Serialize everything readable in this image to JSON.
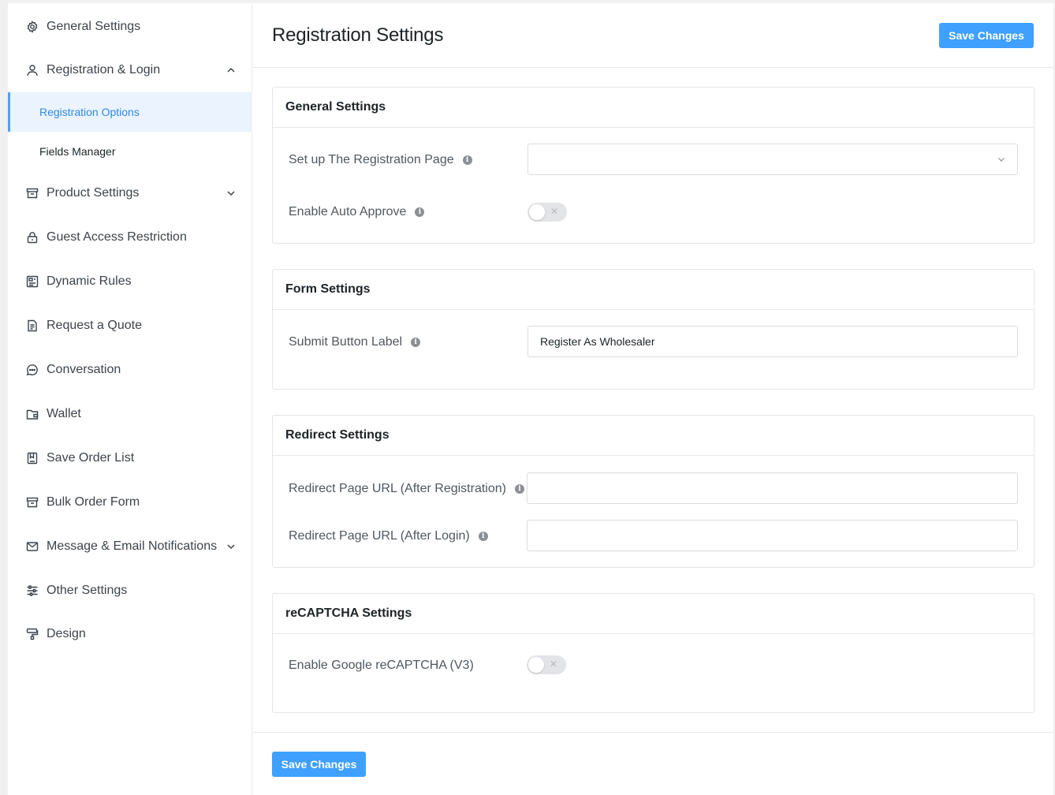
{
  "sidebar": {
    "items": [
      {
        "label": "General Settings",
        "icon": "gear-icon"
      },
      {
        "label": "Registration & Login",
        "icon": "user-icon",
        "expanded": true
      },
      {
        "label": "Product Settings",
        "icon": "archive-box-icon"
      },
      {
        "label": "Guest Access Restriction",
        "icon": "lock-icon"
      },
      {
        "label": "Dynamic Rules",
        "icon": "rules-icon"
      },
      {
        "label": "Request a Quote",
        "icon": "document-icon"
      },
      {
        "label": "Conversation",
        "icon": "chat-bubble-icon"
      },
      {
        "label": "Wallet",
        "icon": "wallet-icon"
      },
      {
        "label": "Save Order List",
        "icon": "bookmark-icon"
      },
      {
        "label": "Bulk Order Form",
        "icon": "archive-box-icon"
      },
      {
        "label": "Message & Email Notifications",
        "icon": "envelope-icon"
      },
      {
        "label": "Other Settings",
        "icon": "sliders-icon"
      },
      {
        "label": "Design",
        "icon": "paint-roller-icon"
      }
    ],
    "sub_items": [
      {
        "label": "Registration Options",
        "active": true
      },
      {
        "label": "Fields Manager",
        "active": false
      }
    ]
  },
  "header": {
    "title": "Registration Settings",
    "save_label": "Save Changes"
  },
  "sections": {
    "general": {
      "title": "General Settings",
      "registration_page_label": "Set up The Registration Page",
      "registration_page_value": "",
      "auto_approve_label": "Enable Auto Approve",
      "auto_approve_on": false
    },
    "form": {
      "title": "Form Settings",
      "submit_label_label": "Submit Button Label",
      "submit_label_value": "Register As Wholesaler"
    },
    "redirect": {
      "title": "Redirect Settings",
      "after_registration_label": "Redirect Page URL (After Registration)",
      "after_registration_value": "",
      "after_login_label": "Redirect Page URL (After Login)",
      "after_login_value": ""
    },
    "recaptcha": {
      "title": "reCAPTCHA Settings",
      "enable_label": "Enable Google reCAPTCHA (V3)",
      "enable_on": false
    }
  },
  "footer": {
    "save_label": "Save Changes"
  },
  "colors": {
    "accent": "#3fa0ff",
    "active_bg": "#eaf3ff",
    "active_text": "#2f8ae6"
  }
}
